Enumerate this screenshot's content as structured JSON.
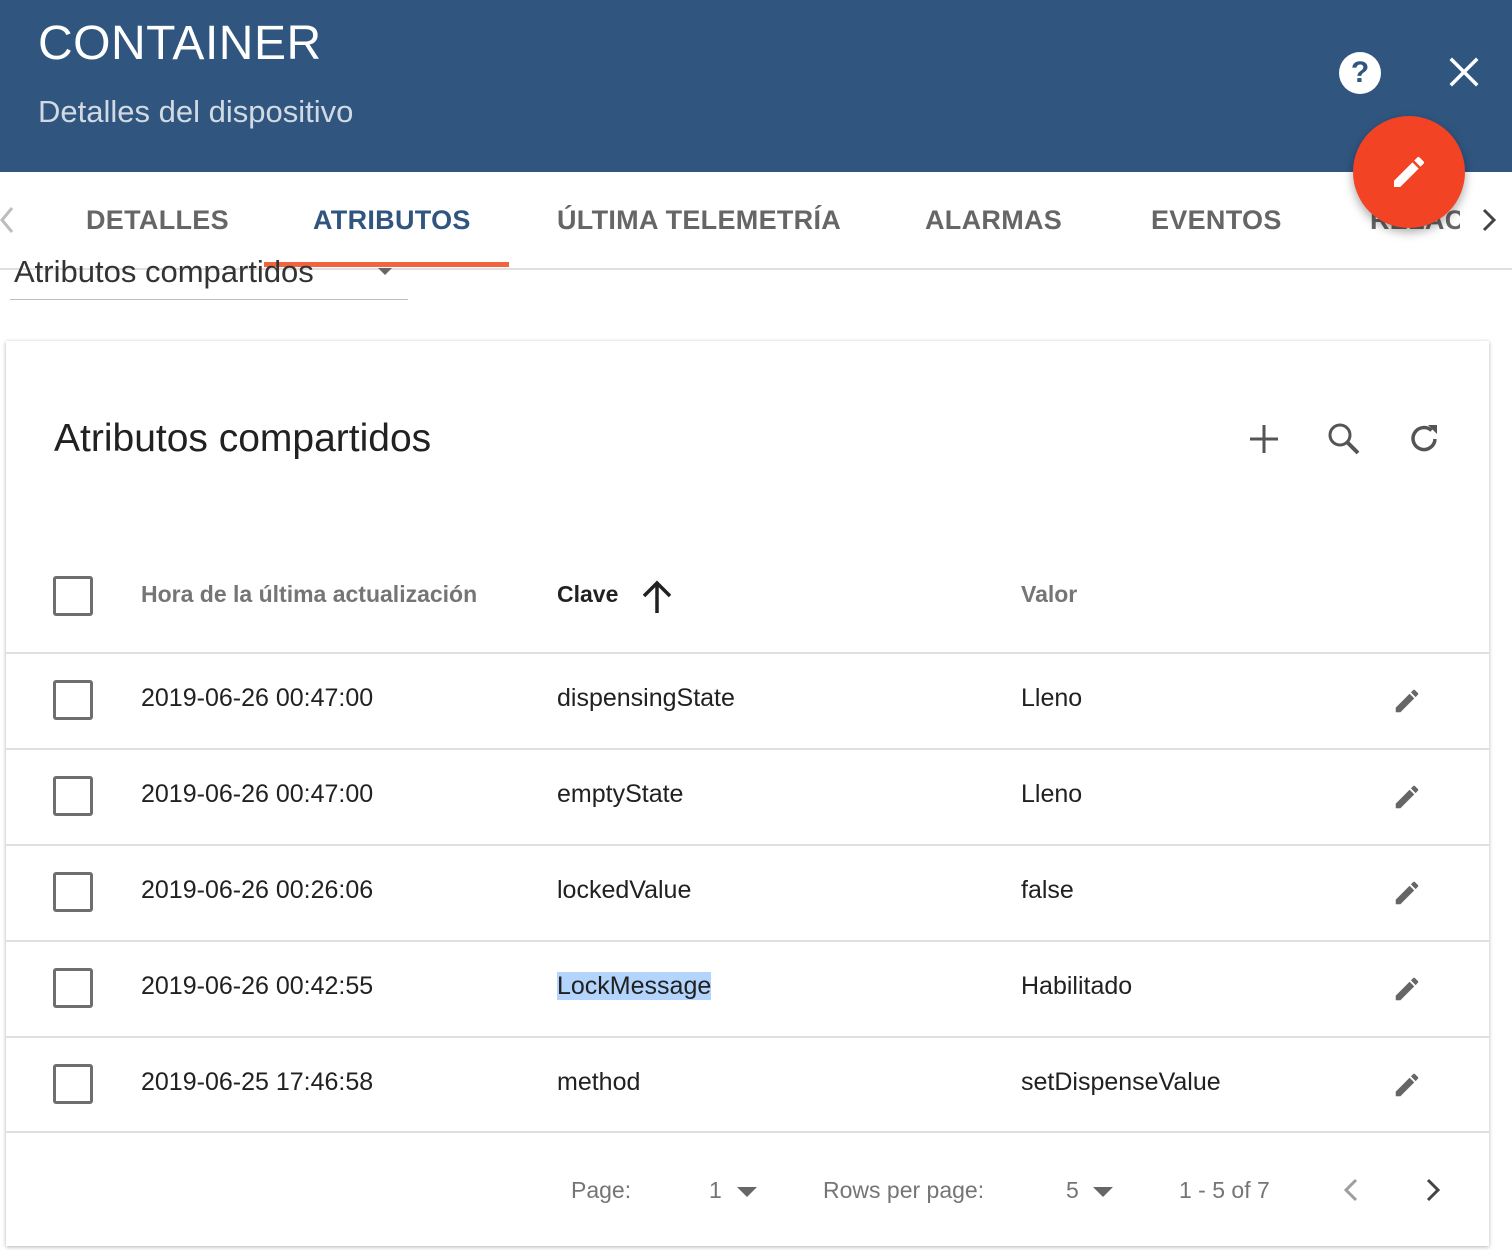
{
  "header": {
    "title": "CONTAINER",
    "subtitle": "Detalles del dispositivo",
    "help_icon": "help-circle-icon",
    "help_glyph": "?",
    "close_icon": "close-icon",
    "edit_fab_icon": "pencil-icon",
    "background_color": "#305680",
    "fab_color": "#f34325"
  },
  "tabs": {
    "items": [
      {
        "label": "DETALLES"
      },
      {
        "label": "ATRIBUTOS",
        "active": true
      },
      {
        "label": "ÚLTIMA TELEMETRÍA"
      },
      {
        "label": "ALARMAS"
      },
      {
        "label": "EVENTOS"
      },
      {
        "label": "RELACI"
      }
    ],
    "ink_color": "#f0643f"
  },
  "scope_selector": {
    "value": "Atributos compartidos"
  },
  "card": {
    "title": "Atributos compartidos",
    "toolbar": {
      "add_icon": "plus-icon",
      "search_icon": "search-icon",
      "refresh_icon": "refresh-icon"
    }
  },
  "table": {
    "columns": {
      "last_update": "Hora de la última actualización",
      "key": "Clave",
      "value": "Valor"
    },
    "sort": {
      "column": "Clave",
      "direction": "asc"
    },
    "rows": [
      {
        "last_update": "2019-06-26 00:47:00",
        "key": "dispensingState",
        "value": "Lleno"
      },
      {
        "last_update": "2019-06-26 00:47:00",
        "key": "emptyState",
        "value": "Lleno"
      },
      {
        "last_update": "2019-06-26 00:26:06",
        "key": "lockedValue",
        "value": "false"
      },
      {
        "last_update": "2019-06-26 00:42:55",
        "key": "LockMessage",
        "value": "Habilitado"
      },
      {
        "last_update": "2019-06-25 17:46:58",
        "key": "method",
        "value": "setDispenseValue"
      }
    ]
  },
  "pagination": {
    "page_label": "Page:",
    "page_value": "1",
    "rows_label": "Rows per page:",
    "rows_value": "5",
    "range": "1 - 5 of 7"
  }
}
